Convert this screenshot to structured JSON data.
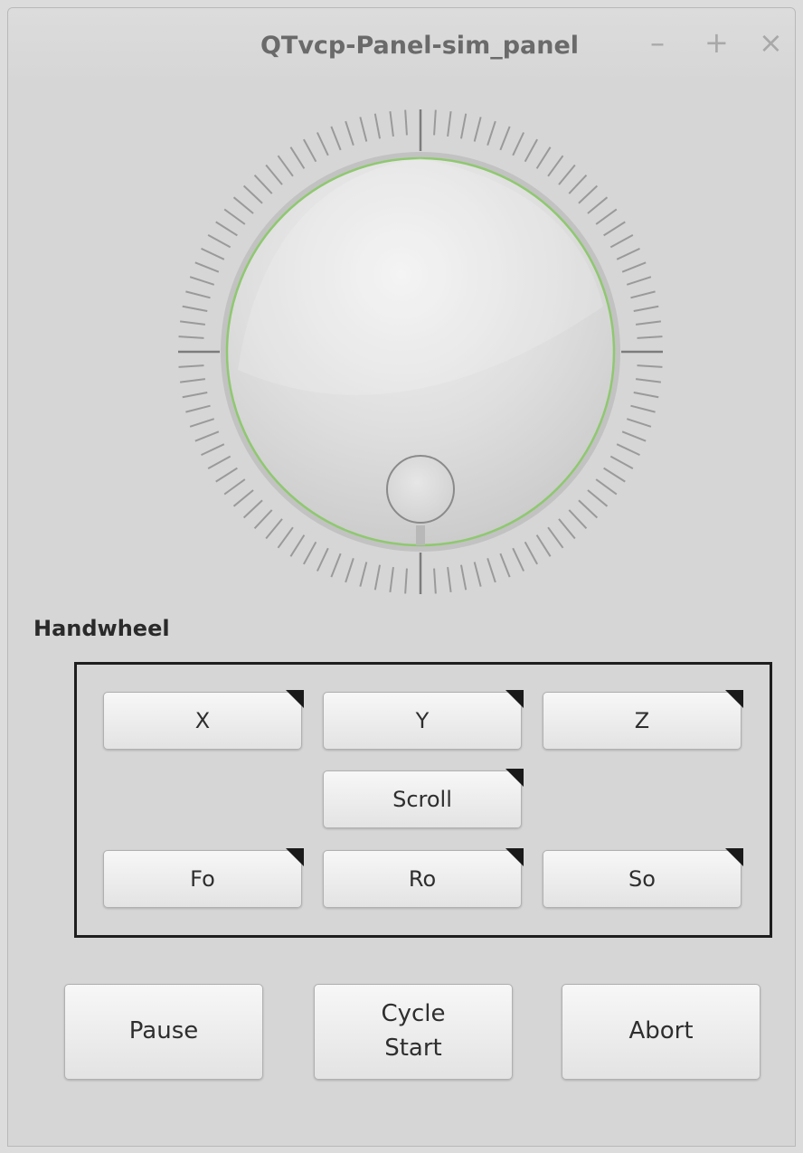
{
  "window": {
    "title": "QTvcp-Panel-sim_panel",
    "controls": {
      "minimize": "–",
      "maximize": "+",
      "close": "×"
    }
  },
  "handwheel": {
    "label": "Handwheel",
    "accent_color": "#8fc870",
    "axis_buttons": [
      "X",
      "Y",
      "Z"
    ],
    "scroll_button": "Scroll",
    "override_buttons": [
      "Fo",
      "Ro",
      "So"
    ]
  },
  "actions": {
    "pause": "Pause",
    "cycle_start_line1": "Cycle",
    "cycle_start_line2": "Start",
    "abort": "Abort"
  }
}
